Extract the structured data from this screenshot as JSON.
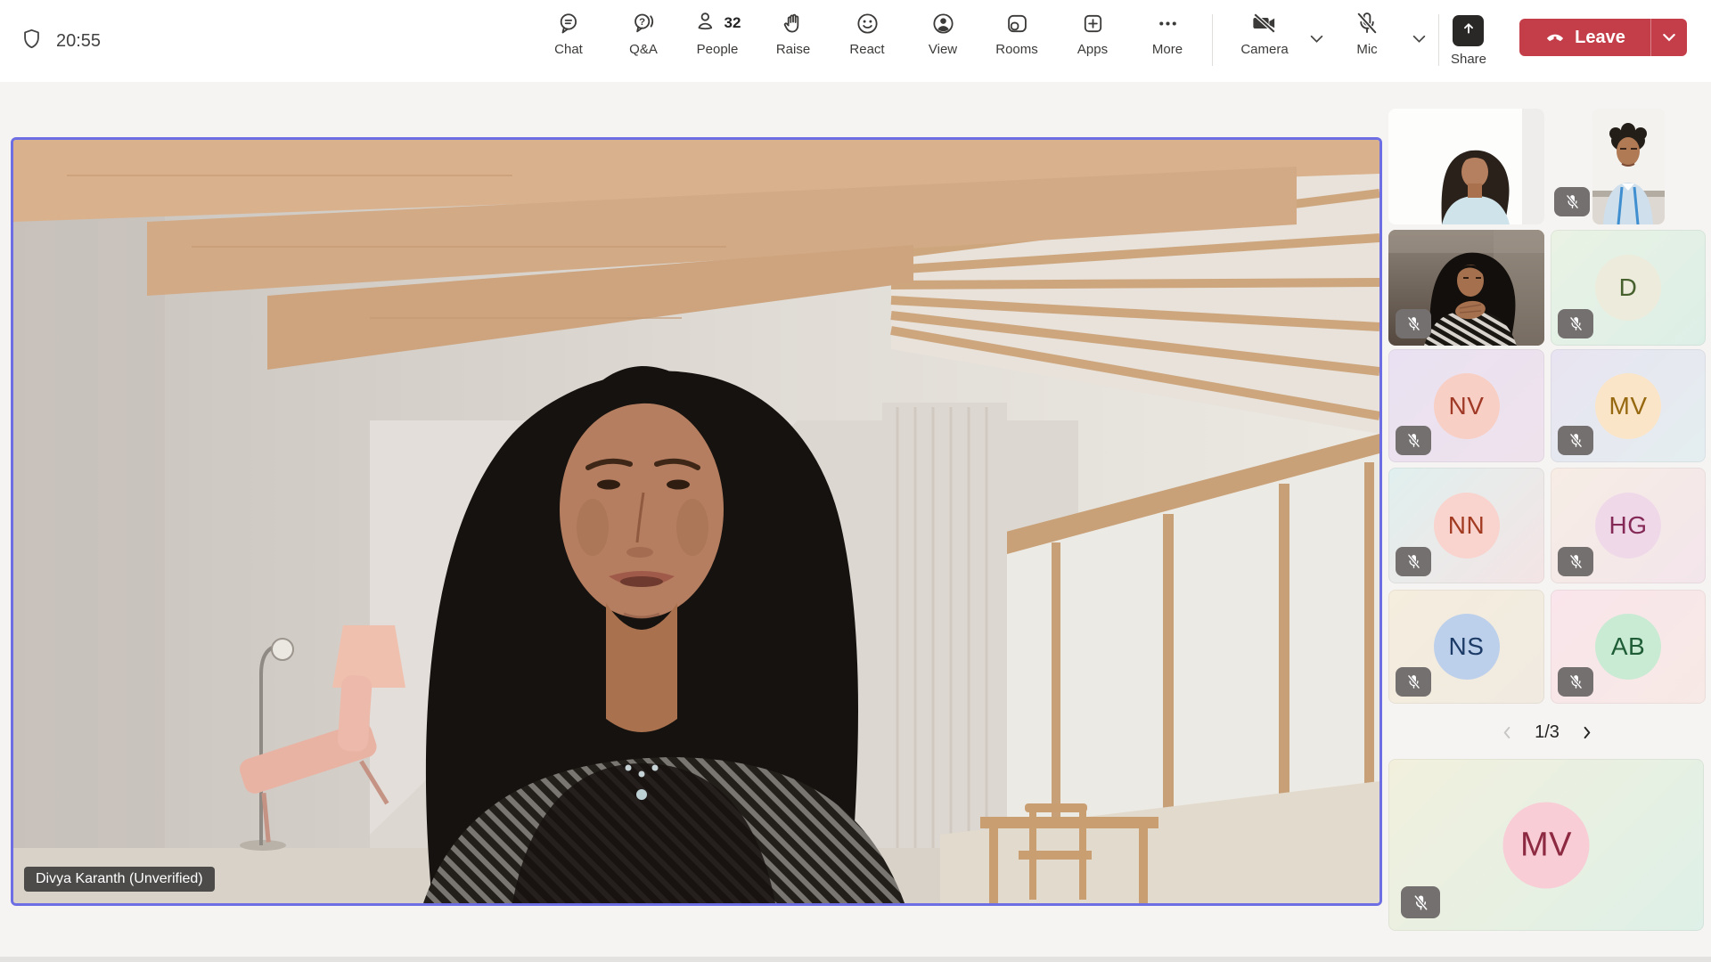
{
  "meeting": {
    "timer": "20:55",
    "active_speaker_label": "Divya Karanth (Unverified)",
    "pagination": "1/3"
  },
  "toolbar": {
    "items": [
      {
        "label": "Chat"
      },
      {
        "label": "Q&A"
      },
      {
        "label": "People",
        "badge": "32"
      },
      {
        "label": "Raise"
      },
      {
        "label": "React"
      },
      {
        "label": "View"
      },
      {
        "label": "Rooms"
      },
      {
        "label": "Apps"
      },
      {
        "label": "More"
      },
      {
        "label": "Camera",
        "state": "off"
      },
      {
        "label": "Mic",
        "state": "off"
      },
      {
        "label": "Share"
      }
    ],
    "leave_label": "Leave"
  },
  "sidebar": {
    "video_tiles": [
      {
        "position": "row1-left",
        "muted": false
      },
      {
        "position": "row1-right-portrait",
        "muted": true
      },
      {
        "position": "row2-left",
        "muted": true
      }
    ],
    "avatars": [
      {
        "initials": "D",
        "muted": true,
        "tile_bg": "linear-gradient(135deg,#eaf2e4,#dcefe7)",
        "circle_bg": "#edebdc",
        "letter_color": "#46602e"
      },
      {
        "initials": "NV",
        "muted": true,
        "tile_bg": "linear-gradient(135deg,#eae2f2,#eee2ec)",
        "circle_bg": "#f8cfc5",
        "letter_color": "#a03a27"
      },
      {
        "initials": "MV",
        "muted": true,
        "tile_bg": "linear-gradient(135deg,#e8e4f1,#e4eef0)",
        "circle_bg": "#fbe5c8",
        "letter_color": "#96680f"
      },
      {
        "initials": "NN",
        "muted": true,
        "tile_bg": "linear-gradient(135deg,#e0f0ee,#f4e4e5)",
        "circle_bg": "#f9d3cd",
        "letter_color": "#a23b22"
      },
      {
        "initials": "HG",
        "muted": true,
        "tile_bg": "linear-gradient(135deg,#f7ede5,#f3e5eb)",
        "circle_bg": "#efd9e9",
        "letter_color": "#852a57"
      },
      {
        "initials": "NS",
        "muted": true,
        "tile_bg": "linear-gradient(135deg,#f5eddd,#f0eae1)",
        "circle_bg": "#bdd0eb",
        "letter_color": "#1d3b67"
      },
      {
        "initials": "AB",
        "muted": true,
        "tile_bg": "linear-gradient(135deg,#f9e5eb,#f7e9e5)",
        "circle_bg": "#c9ead3",
        "letter_color": "#1e5d36"
      },
      {
        "initials": "MV",
        "muted": true,
        "size": "large",
        "tile_bg": "linear-gradient(135deg,#f2f0dd,#def0e7)",
        "circle_bg": "#f8cdd6",
        "letter_color": "#8d2a41"
      }
    ],
    "pagination": {
      "label": "1/3",
      "prev_enabled": false,
      "next_enabled": true
    }
  },
  "colors": {
    "stage-bg": "#f6f4f2",
    "topbar-bg": "#ffffff",
    "icon-color": "#3b3a39",
    "leave-red": "#c43e49",
    "active-border": "#6e6ee4",
    "badge-bg": "#757070"
  }
}
